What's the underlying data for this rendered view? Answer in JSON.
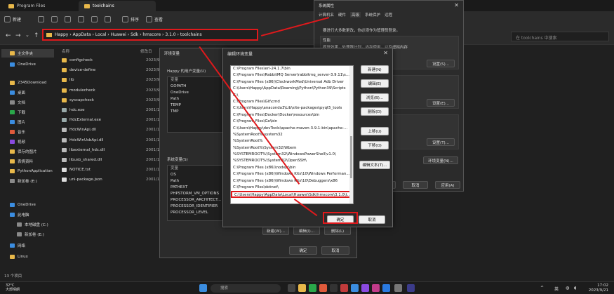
{
  "explorer": {
    "tabs": [
      "Program Files",
      "toolchains"
    ],
    "toolbar": {
      "new": "新建",
      "sort": "排序",
      "view": "查看"
    },
    "breadcrumb": "Happy  ›  AppData  ›  Local  ›  Huawei  ›  Sdk  ›  hmscore  ›  3.1.0  ›  toolchains",
    "search_placeholder": "在 toolchains 中搜索",
    "columns": {
      "name": "名称",
      "date": "修改日"
    },
    "files": [
      {
        "name": "configcheck",
        "date": "2023/9/21",
        "kind": "folder"
      },
      {
        "name": "device-define",
        "date": "2023/9/21",
        "kind": "folder"
      },
      {
        "name": "lib",
        "date": "2023/9/21",
        "kind": "folder"
      },
      {
        "name": "modulecheck",
        "date": "2023/9/21",
        "kind": "folder"
      },
      {
        "name": "syscapcheck",
        "date": "2023/9/21",
        "kind": "folder"
      },
      {
        "name": "hdc.exe",
        "date": "2001/1/1",
        "kind": "exe"
      },
      {
        "name": "HdcExternal.exe",
        "date": "2001/1/1",
        "kind": "exe"
      },
      {
        "name": "HdcWinApi.dll",
        "date": "2001/1/1",
        "kind": "dll"
      },
      {
        "name": "HdcWinUsbApi.dll",
        "date": "2001/1/1",
        "kind": "dll"
      },
      {
        "name": "libexternal_hdc.dll",
        "date": "2001/1/1",
        "kind": "dll"
      },
      {
        "name": "libusb_shared.dll",
        "date": "2001/1/1",
        "kind": "dll"
      },
      {
        "name": "NOTICE.txt",
        "date": "2001/1/1",
        "kind": "txt"
      },
      {
        "name": "uni-package.json",
        "date": "2001/1/1",
        "kind": "json"
      }
    ],
    "sidebar": [
      {
        "label": "主文件夹",
        "color": "#e8b84a"
      },
      {
        "label": "OneDrive",
        "color": "#3b8de0"
      },
      {
        "label": "2345Download",
        "color": "#e8b84a"
      },
      {
        "label": "桌面",
        "color": "#3b8de0"
      },
      {
        "label": "文档",
        "color": "#8a8a8a"
      },
      {
        "label": "下载",
        "color": "#2aa84a"
      },
      {
        "label": "图片",
        "color": "#3b8de0"
      },
      {
        "label": "音乐",
        "color": "#e05a3b"
      },
      {
        "label": "视频",
        "color": "#8a4ae0"
      },
      {
        "label": "保存的图片",
        "color": "#e8b84a"
      },
      {
        "label": "表情资料",
        "color": "#e8b84a"
      },
      {
        "label": "PythonApplication",
        "color": "#e8b84a"
      },
      {
        "label": "新加卷 (E:)",
        "color": "#8a8a8a"
      },
      {
        "label": "OneDrive",
        "color": "#3b8de0"
      },
      {
        "label": "此电脑",
        "color": "#3b8de0"
      },
      {
        "label": "本地磁盘 (C:)",
        "color": "#8a8a8a"
      },
      {
        "label": "新加卷 (E:)",
        "color": "#8a8a8a"
      },
      {
        "label": "网络",
        "color": "#3b8de0"
      },
      {
        "label": "Linux",
        "color": "#e8b84a"
      }
    ],
    "status": "13 个项目"
  },
  "sysprops": {
    "title": "系统属性",
    "tabs": [
      "计算机名",
      "硬件",
      "高级",
      "系统保护",
      "远程"
    ],
    "admin_note": "要进行大多数更改，你必须作为管理员登录。",
    "perf_title": "性能",
    "perf_desc": "视觉效果，处理器计划，内存使用，以及虚拟内存",
    "settings": "设置(S)...",
    "settings_e": "设置(E)...",
    "settings_t": "设置(T)...",
    "env_button": "环境变量(N)...",
    "ok": "确定",
    "cancel": "取消",
    "apply": "应用(A)"
  },
  "envvars": {
    "title": "环境变量",
    "user_label": "Happy 的用户变量(U)",
    "user_header": "变量",
    "user_vars": [
      "GOPATH",
      "OneDrive",
      "Path",
      "TEMP",
      "TMP"
    ],
    "sys_label": "系统变量(S)",
    "sys_header": "变量",
    "sys_vars": [
      "OS",
      "Path",
      "PATHEXT",
      "PHPSTORM_VM_OPTIONS",
      "PROCESSOR_ARCHITECT...",
      "PROCESSOR_IDENTIFIER",
      "PROCESSOR_LEVEL"
    ],
    "new_w": "新建(W)...",
    "edit_i": "编辑(I)...",
    "delete_l": "删除(L)",
    "ok": "确定",
    "cancel": "取消"
  },
  "editenv": {
    "title": "编辑环境变量",
    "paths": [
      "C:\\Program Files\\erl-24.1.7\\bin",
      "C:\\Program Files\\RabbitMQ Server\\rabbitmq_server-3.9.11\\s...",
      "C:\\Program Files (x86)\\ClockworkMod\\Universal Adb Driver",
      "C:\\Users\\Happy\\AppData\\Roaming\\Python\\Python39\\Scripts",
      "C:\\",
      "C:\\Program Files\\Git\\cmd",
      "C:\\Users\\Happy\\anaconda3\\Lib\\site-packages\\pyqt5_tools",
      "C:\\Program Files\\Docker\\Docker\\resources\\bin",
      "C:\\Program Files\\Go\\bin",
      "C:\\Users\\Happy\\devTools\\apache-maven-3.9.1-bin\\apache-...",
      "%SystemRoot%\\system32",
      "%SystemRoot%",
      "%SystemRoot%\\System32\\Wbem",
      "%SYSTEMROOT%\\System32\\WindowsPowerShell\\v1.0\\",
      "%SYSTEMROOT%\\System32\\OpenSSH\\",
      "C:\\Program Files (x86)\\nodejs\\bin",
      "C:\\Program Files (x86)\\Windows Kits\\10\\Windows Performan...",
      "C:\\Program Files (x86)\\Windows Kits\\10\\Debuggers\\x86",
      "C:\\Program Files\\dotnet\\",
      "C:\\Users\\Happy\\AppData\\Local\\Huawei\\Sdk\\hmscore\\3.1.0\\t..."
    ],
    "buttons": [
      "新建(N)",
      "编辑(E)",
      "浏览(B)...",
      "删除(D)",
      "上移(U)",
      "下移(O)",
      "编辑文本(T)..."
    ],
    "ok": "确定",
    "cancel": "取消"
  },
  "taskbar": {
    "temp": "32°C",
    "weather": "大部晴朗",
    "search": "搜索",
    "ime": "英",
    "time": "17:02",
    "date": "2023/9/21"
  },
  "colors": {
    "highlight_red": "#e0191c",
    "folder": "#e8b84a"
  }
}
